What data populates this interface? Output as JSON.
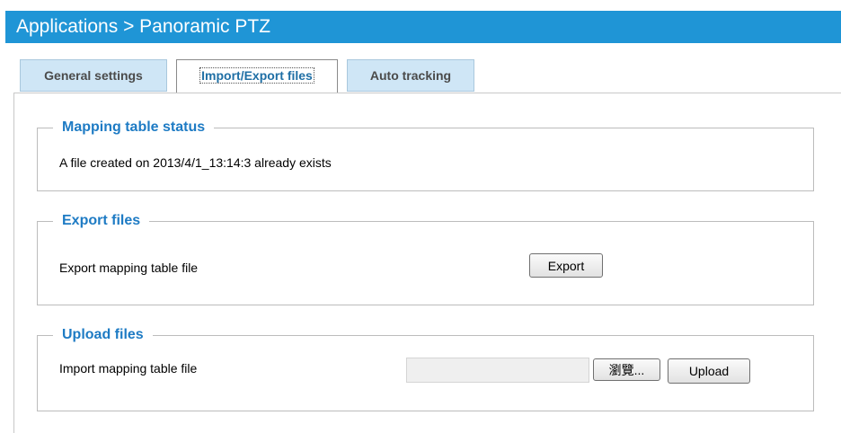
{
  "header": {
    "title": "Applications  > Panoramic PTZ"
  },
  "tabs": [
    {
      "label": "General settings"
    },
    {
      "label": "Import/Export files"
    },
    {
      "label": "Auto tracking"
    }
  ],
  "mapping_status": {
    "legend": "Mapping table status",
    "message": "A file created on 2013/4/1_13:14:3 already exists"
  },
  "export_files": {
    "legend": "Export files",
    "label": "Export mapping table file",
    "button": "Export"
  },
  "upload_files": {
    "legend": "Upload files",
    "label": "Import mapping table file",
    "file_value": "",
    "browse_button": "瀏覽...",
    "upload_button": "Upload"
  }
}
